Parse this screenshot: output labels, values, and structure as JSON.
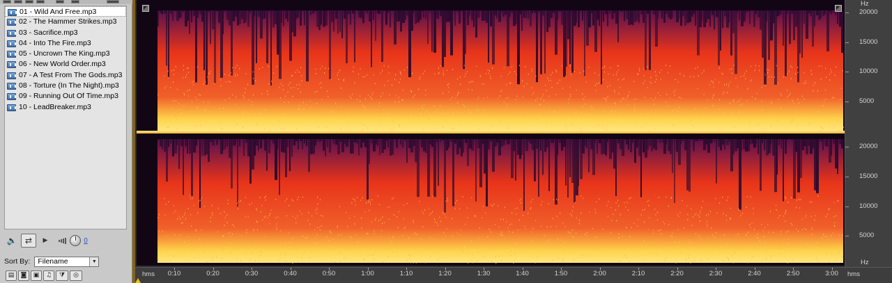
{
  "files": [
    {
      "label": "01 - Wild And Free.mp3",
      "selected": true
    },
    {
      "label": "02 - The Hammer Strikes.mp3"
    },
    {
      "label": "03 - Sacrifice.mp3"
    },
    {
      "label": "04 - Into The Fire.mp3"
    },
    {
      "label": "05 - Uncrown The King.mp3"
    },
    {
      "label": "06 - New World Order.mp3"
    },
    {
      "label": "07 - A Test From The Gods.mp3"
    },
    {
      "label": "08 - Torture (In The Night).mp3"
    },
    {
      "label": "09 - Running Out Of Time.mp3"
    },
    {
      "label": "10 - LeadBreaker.mp3"
    }
  ],
  "transport": {
    "volume_value": "0",
    "icons": [
      "speaker-icon",
      "loop-icon",
      "play-icon",
      "volume-meter-icon",
      "volume-knob"
    ]
  },
  "sort": {
    "label": "Sort By:",
    "value": "Filename"
  },
  "bottom_toolbar": {
    "icons": [
      "toolbar-icon-1",
      "toolbar-icon-2",
      "toolbar-icon-3",
      "toolbar-icon-4",
      "filter-icon",
      "cd-icon"
    ]
  },
  "hz_axis": {
    "unit": "Hz",
    "top_channel_labels": [
      "20000",
      "15000",
      "10000",
      "5000"
    ],
    "bottom_channel_labels": [
      "20000",
      "15000",
      "10000",
      "5000"
    ],
    "bottom_unit": "Hz"
  },
  "time_axis": {
    "unit_left": "hms",
    "unit_right": "hms",
    "labels": [
      "0:10",
      "0:20",
      "0:30",
      "0:40",
      "0:50",
      "1:00",
      "1:10",
      "1:20",
      "1:30",
      "1:40",
      "1:50",
      "2:00",
      "2:10",
      "2:20",
      "2:30",
      "2:40",
      "2:50",
      "3:00"
    ]
  },
  "colors": {
    "spectrum_hot": "#ffd24a",
    "spectrum_mid": "#e8341a",
    "spectrum_low": "#5a1248",
    "background": "#120615",
    "playhead": "#f2c200"
  }
}
